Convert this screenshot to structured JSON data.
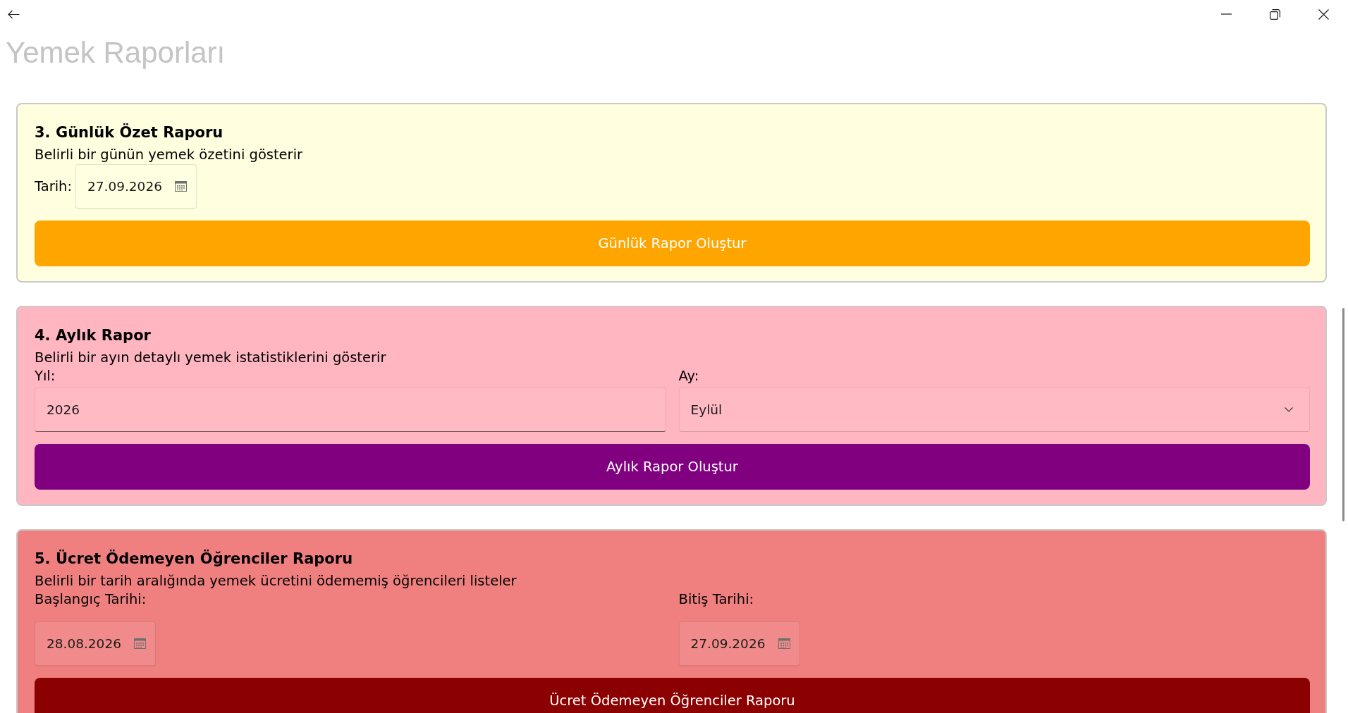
{
  "page": {
    "title": "Yemek Raporları"
  },
  "reports": [
    {
      "kind": "inline",
      "title": "3. Günlük Özet Raporu",
      "description": "Belirli bir günün yemek özetini gösterir",
      "color": "#ffffe0",
      "fields": [
        {
          "kind": "date",
          "label": "Tarih:",
          "value": "27.09.2026"
        }
      ],
      "button": {
        "label": "Günlük Rapor Oluştur",
        "color": "#ffa500"
      }
    },
    {
      "kind": "columns",
      "title": "4. Aylık Rapor",
      "description": "Belirli bir ayın detaylı yemek istatistiklerini gösterir",
      "color": "#ffb6c1",
      "fields": [
        {
          "kind": "text",
          "label": "Yıl:",
          "value": "2026"
        },
        {
          "kind": "select",
          "label": "Ay:",
          "value": "Eylül"
        }
      ],
      "button": {
        "label": "Aylık Rapor Oluştur",
        "color": "#800080"
      }
    },
    {
      "kind": "columns",
      "title": "5. Ücret Ödemeyen Öğrenciler Raporu",
      "description": "Belirli bir tarih aralığında yemek ücretini ödememiş öğrencileri listeler",
      "color": "#f08080",
      "fields": [
        {
          "kind": "date",
          "label": "Başlangıç Tarihi:",
          "value": "28.08.2026"
        },
        {
          "kind": "date",
          "label": "Bitiş Tarihi:",
          "value": "27.09.2026"
        }
      ],
      "button": {
        "label": "Ücret Ödemeyen Öğrenciler Raporu",
        "color": "#8b0000"
      }
    }
  ]
}
